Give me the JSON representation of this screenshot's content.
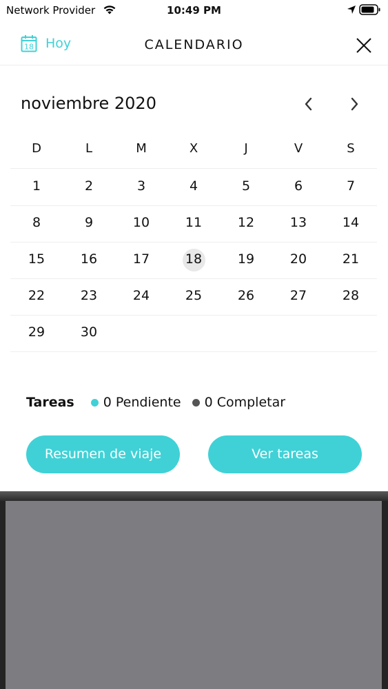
{
  "status_bar": {
    "carrier": "Network Provider",
    "time": "10:49 PM"
  },
  "header": {
    "today_label": "Hoy",
    "today_icon_number": "18",
    "title": "CALENDARIO"
  },
  "calendar": {
    "month_title": "noviembre 2020",
    "weekdays": [
      "D",
      "L",
      "M",
      "X",
      "J",
      "V",
      "S"
    ],
    "weeks": [
      [
        "1",
        "2",
        "3",
        "4",
        "5",
        "6",
        "7"
      ],
      [
        "8",
        "9",
        "10",
        "11",
        "12",
        "13",
        "14"
      ],
      [
        "15",
        "16",
        "17",
        "18",
        "19",
        "20",
        "21"
      ],
      [
        "22",
        "23",
        "24",
        "25",
        "26",
        "27",
        "28"
      ],
      [
        "29",
        "30",
        "",
        "",
        "",
        "",
        ""
      ]
    ],
    "selected_day": "18"
  },
  "tasks": {
    "label": "Tareas",
    "pending": "0 Pendiente",
    "completed": "0 Completar",
    "pending_color": "#40d1d6",
    "completed_color": "#555555"
  },
  "buttons": {
    "summary": "Resumen de viaje",
    "view_tasks": "Ver tareas"
  },
  "colors": {
    "accent": "#40d1d6",
    "selected_day_bg": "#e8e8e8"
  }
}
